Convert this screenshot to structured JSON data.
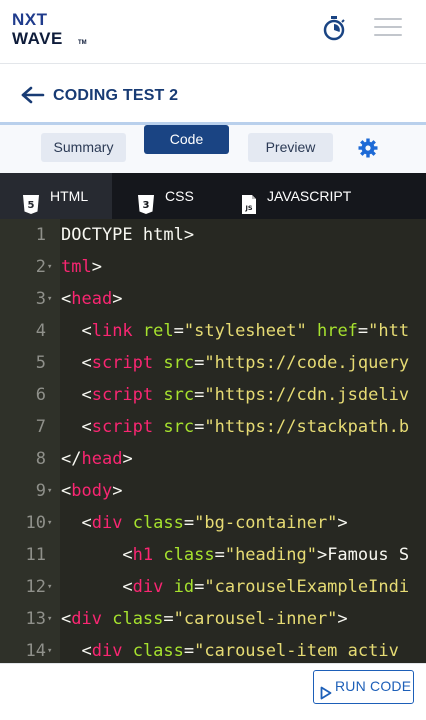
{
  "header": {
    "logo_line1": "NXT",
    "logo_line2": "WAVE",
    "logo_tm": "TM"
  },
  "title_bar": {
    "title": "CODING TEST 2"
  },
  "tabs": [
    {
      "label": "Summary",
      "active": false
    },
    {
      "label": "Code",
      "active": true
    },
    {
      "label": "Preview",
      "active": false
    }
  ],
  "languages": [
    {
      "label": "HTML",
      "icon": "html5-icon",
      "active": true
    },
    {
      "label": "CSS",
      "icon": "css3-icon",
      "active": false
    },
    {
      "label": "JAVASCRIPT",
      "icon": "js-file-icon",
      "active": false
    }
  ],
  "editor": {
    "lines": [
      {
        "n": "1",
        "fold": false,
        "segments": [
          {
            "t": "p",
            "v": "DOCTYPE html>"
          }
        ]
      },
      {
        "n": "2",
        "fold": true,
        "segments": [
          {
            "t": "t",
            "v": "tml"
          },
          {
            "t": "p",
            "v": ">"
          }
        ]
      },
      {
        "n": "3",
        "fold": true,
        "segments": [
          {
            "t": "p",
            "v": "<"
          },
          {
            "t": "t",
            "v": "head"
          },
          {
            "t": "p",
            "v": ">"
          }
        ]
      },
      {
        "n": "4",
        "fold": false,
        "segments": [
          {
            "t": "p",
            "v": "  <"
          },
          {
            "t": "t",
            "v": "link"
          },
          {
            "t": "p",
            "v": " "
          },
          {
            "t": "a",
            "v": "rel"
          },
          {
            "t": "p",
            "v": "="
          },
          {
            "t": "s",
            "v": "\"stylesheet\""
          },
          {
            "t": "p",
            "v": " "
          },
          {
            "t": "a",
            "v": "href"
          },
          {
            "t": "p",
            "v": "="
          },
          {
            "t": "s",
            "v": "\"htt"
          }
        ]
      },
      {
        "n": "5",
        "fold": false,
        "segments": [
          {
            "t": "p",
            "v": "  <"
          },
          {
            "t": "t",
            "v": "script"
          },
          {
            "t": "p",
            "v": " "
          },
          {
            "t": "a",
            "v": "src"
          },
          {
            "t": "p",
            "v": "="
          },
          {
            "t": "s",
            "v": "\"https://code.jquery"
          }
        ]
      },
      {
        "n": "6",
        "fold": false,
        "segments": [
          {
            "t": "p",
            "v": "  <"
          },
          {
            "t": "t",
            "v": "script"
          },
          {
            "t": "p",
            "v": " "
          },
          {
            "t": "a",
            "v": "src"
          },
          {
            "t": "p",
            "v": "="
          },
          {
            "t": "s",
            "v": "\"https://cdn.jsdeliv"
          }
        ]
      },
      {
        "n": "7",
        "fold": false,
        "segments": [
          {
            "t": "p",
            "v": "  <"
          },
          {
            "t": "t",
            "v": "script"
          },
          {
            "t": "p",
            "v": " "
          },
          {
            "t": "a",
            "v": "src"
          },
          {
            "t": "p",
            "v": "="
          },
          {
            "t": "s",
            "v": "\"https://stackpath.b"
          }
        ]
      },
      {
        "n": "8",
        "fold": false,
        "segments": [
          {
            "t": "p",
            "v": "</"
          },
          {
            "t": "t",
            "v": "head"
          },
          {
            "t": "p",
            "v": ">"
          }
        ]
      },
      {
        "n": "9",
        "fold": true,
        "segments": [
          {
            "t": "p",
            "v": "<"
          },
          {
            "t": "t",
            "v": "body"
          },
          {
            "t": "p",
            "v": ">"
          }
        ]
      },
      {
        "n": "10",
        "fold": true,
        "segments": [
          {
            "t": "p",
            "v": "  <"
          },
          {
            "t": "t",
            "v": "div"
          },
          {
            "t": "p",
            "v": " "
          },
          {
            "t": "a",
            "v": "class"
          },
          {
            "t": "p",
            "v": "="
          },
          {
            "t": "s",
            "v": "\"bg-container\""
          },
          {
            "t": "p",
            "v": ">"
          }
        ]
      },
      {
        "n": "11",
        "fold": false,
        "segments": [
          {
            "t": "p",
            "v": "      <"
          },
          {
            "t": "t",
            "v": "h1"
          },
          {
            "t": "p",
            "v": " "
          },
          {
            "t": "a",
            "v": "class"
          },
          {
            "t": "p",
            "v": "="
          },
          {
            "t": "s",
            "v": "\"heading\""
          },
          {
            "t": "p",
            "v": ">Famous S"
          }
        ]
      },
      {
        "n": "12",
        "fold": true,
        "segments": [
          {
            "t": "p",
            "v": "      <"
          },
          {
            "t": "t",
            "v": "div"
          },
          {
            "t": "p",
            "v": " "
          },
          {
            "t": "a",
            "v": "id"
          },
          {
            "t": "p",
            "v": "="
          },
          {
            "t": "s",
            "v": "\"carouselExampleIndi"
          }
        ]
      },
      {
        "n": "13",
        "fold": true,
        "segments": [
          {
            "t": "p",
            "v": "<"
          },
          {
            "t": "t",
            "v": "div"
          },
          {
            "t": "p",
            "v": " "
          },
          {
            "t": "a",
            "v": "class"
          },
          {
            "t": "p",
            "v": "="
          },
          {
            "t": "s",
            "v": "\"carousel-inner\""
          },
          {
            "t": "p",
            "v": ">"
          }
        ]
      },
      {
        "n": "14",
        "fold": true,
        "segments": [
          {
            "t": "p",
            "v": "  <"
          },
          {
            "t": "t",
            "v": "div"
          },
          {
            "t": "p",
            "v": " "
          },
          {
            "t": "a",
            "v": "class"
          },
          {
            "t": "p",
            "v": "="
          },
          {
            "t": "s",
            "v": "\"carousel-item activ"
          }
        ]
      }
    ]
  },
  "footer": {
    "run_label": "RUN CODE"
  },
  "colors": {
    "brand_dark": "#1a4483",
    "editor_bg": "#272822",
    "tag": "#f92672",
    "attr": "#a6e22e",
    "string": "#e6db74"
  }
}
